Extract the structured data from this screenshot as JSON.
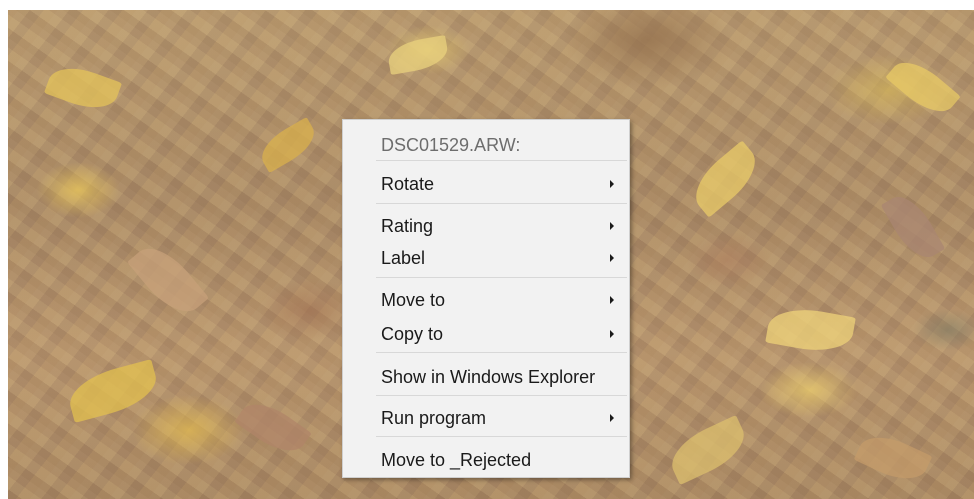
{
  "image_viewer": {
    "photo": "autumn-leaves-photo"
  },
  "context_menu": {
    "header": "DSC01529.ARW:",
    "items": {
      "rotate": "Rotate",
      "rating": "Rating",
      "label": "Label",
      "move_to": "Move to",
      "copy_to": "Copy to",
      "show_in_explorer": "Show in Windows Explorer",
      "run_program": "Run program",
      "move_to_rejected": "Move to _Rejected"
    }
  }
}
